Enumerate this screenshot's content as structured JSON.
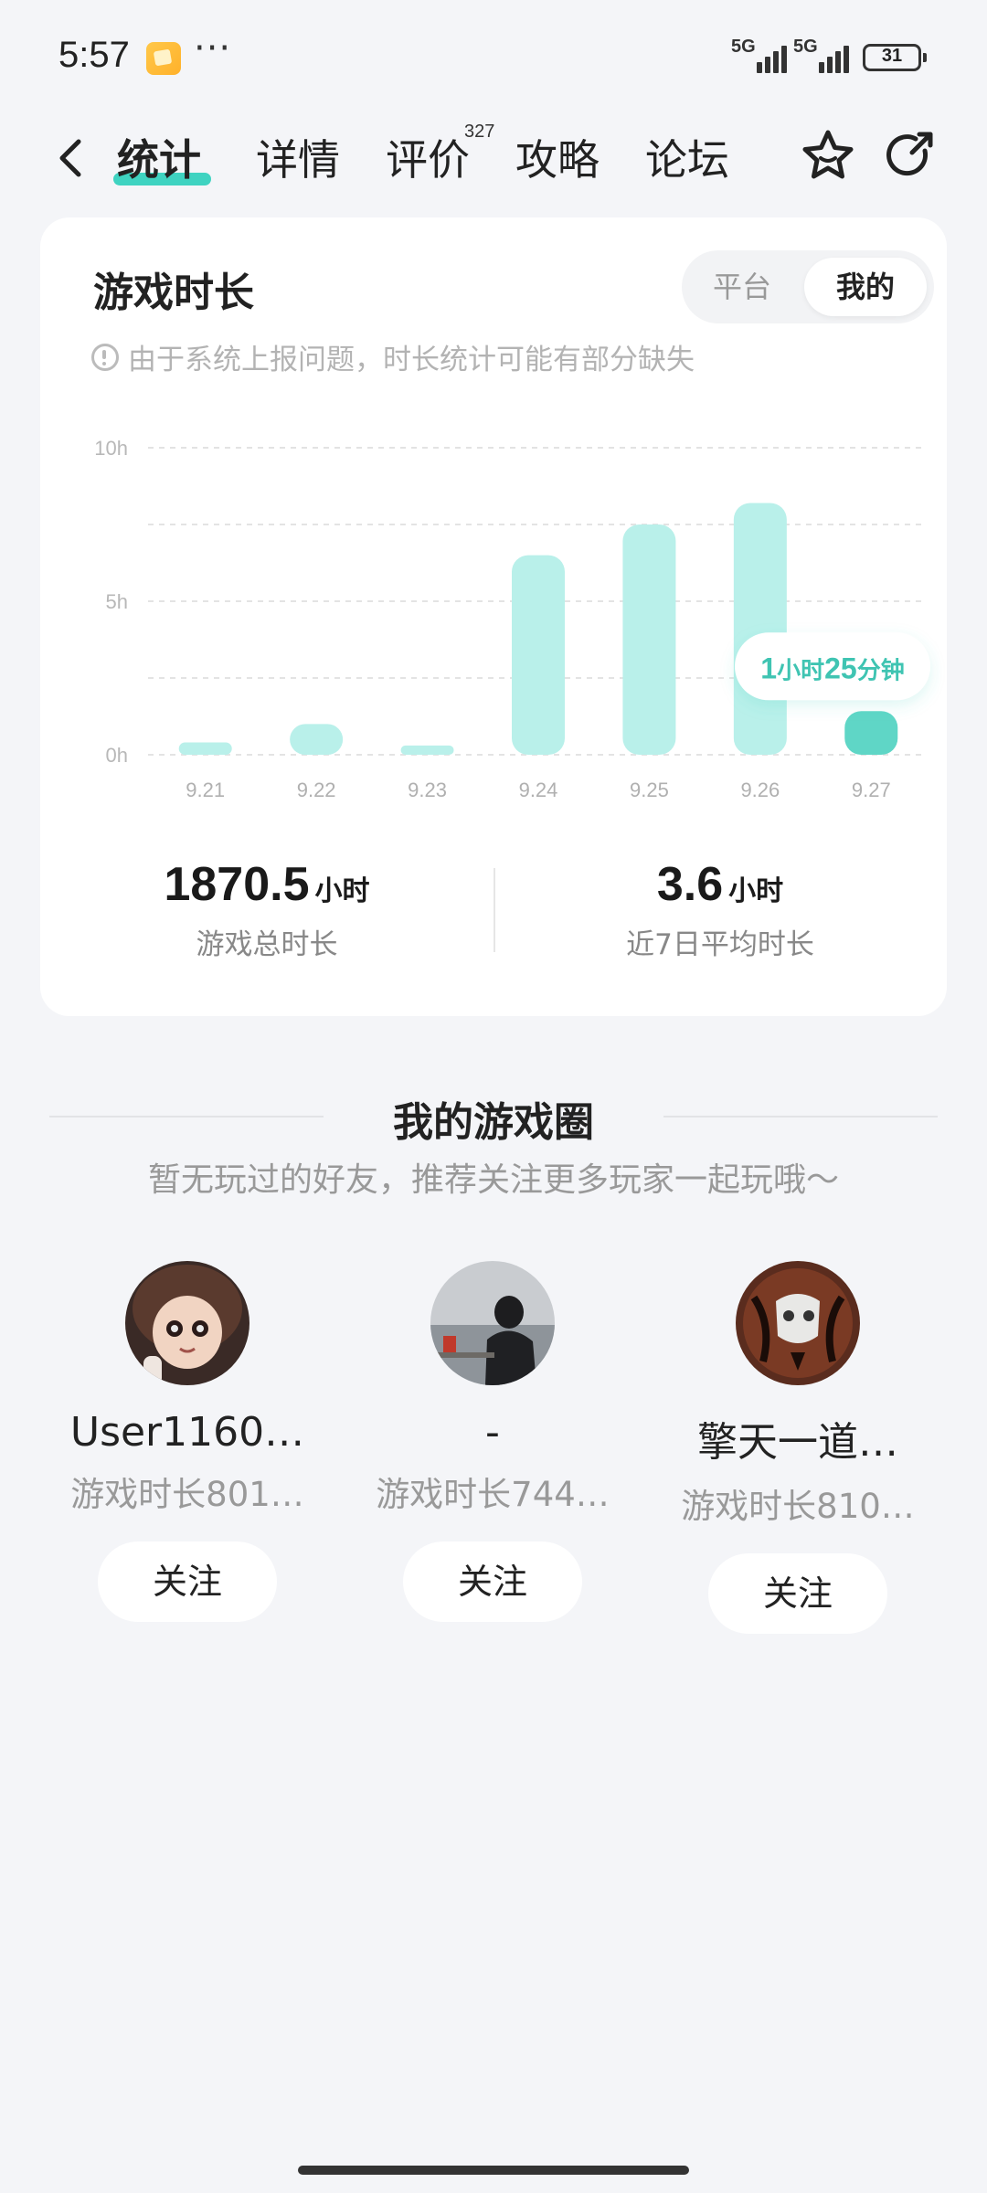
{
  "status_bar": {
    "time": "5:57",
    "more": "···",
    "signal1_label": "5G",
    "signal2_label": "5G",
    "battery": "31"
  },
  "nav": {
    "tabs": [
      {
        "label": "统计",
        "active": true
      },
      {
        "label": "详情",
        "active": false
      },
      {
        "label": "评价",
        "active": false,
        "count": "327"
      },
      {
        "label": "攻略",
        "active": false
      },
      {
        "label": "论坛",
        "active": false
      }
    ],
    "icons": {
      "back": "back-arrow-icon",
      "favorite": "star-icon",
      "share": "share-icon"
    }
  },
  "card": {
    "title": "游戏时长",
    "toggle": {
      "platform": "平台",
      "mine": "我的",
      "selected": "我的"
    },
    "note": "由于系统上报问题，时长统计可能有部分缺失"
  },
  "chart_data": {
    "type": "bar",
    "categories": [
      "9.21",
      "9.22",
      "9.23",
      "9.24",
      "9.25",
      "9.26",
      "9.27"
    ],
    "values": [
      0.4,
      1.0,
      0.3,
      6.5,
      7.5,
      8.2,
      1.42
    ],
    "y_ticks": [
      "0h",
      "5h",
      "10h"
    ],
    "ylim": [
      0,
      10
    ],
    "grid": true,
    "highlight_index": 6,
    "tooltip": {
      "num1": "1",
      "unit1": "小时",
      "num2": "25",
      "unit2": "分钟"
    },
    "colors": {
      "bar": "#b9f0ea",
      "bar_active": "#5fd6c6",
      "tooltip_text": "#3fc4b2"
    }
  },
  "stats": {
    "total": {
      "value": "1870.5",
      "unit": "小时",
      "label": "游戏总时长"
    },
    "avg": {
      "value": "3.6",
      "unit": "小时",
      "label": "近7日平均时长"
    }
  },
  "circle": {
    "title": "我的游戏圈",
    "subtitle": "暂无玩过的好友，推荐关注更多玩家一起玩哦～",
    "friends": [
      {
        "name": "User1160…",
        "duration": "游戏时长801…",
        "follow": "关注"
      },
      {
        "name": "-",
        "duration": "游戏时长744…",
        "follow": "关注"
      },
      {
        "name": "擎天一道…",
        "duration": "游戏时长810…",
        "follow": "关注"
      }
    ]
  },
  "colors": {
    "accent": "#3fd3c1",
    "background": "#f4f5f8"
  }
}
